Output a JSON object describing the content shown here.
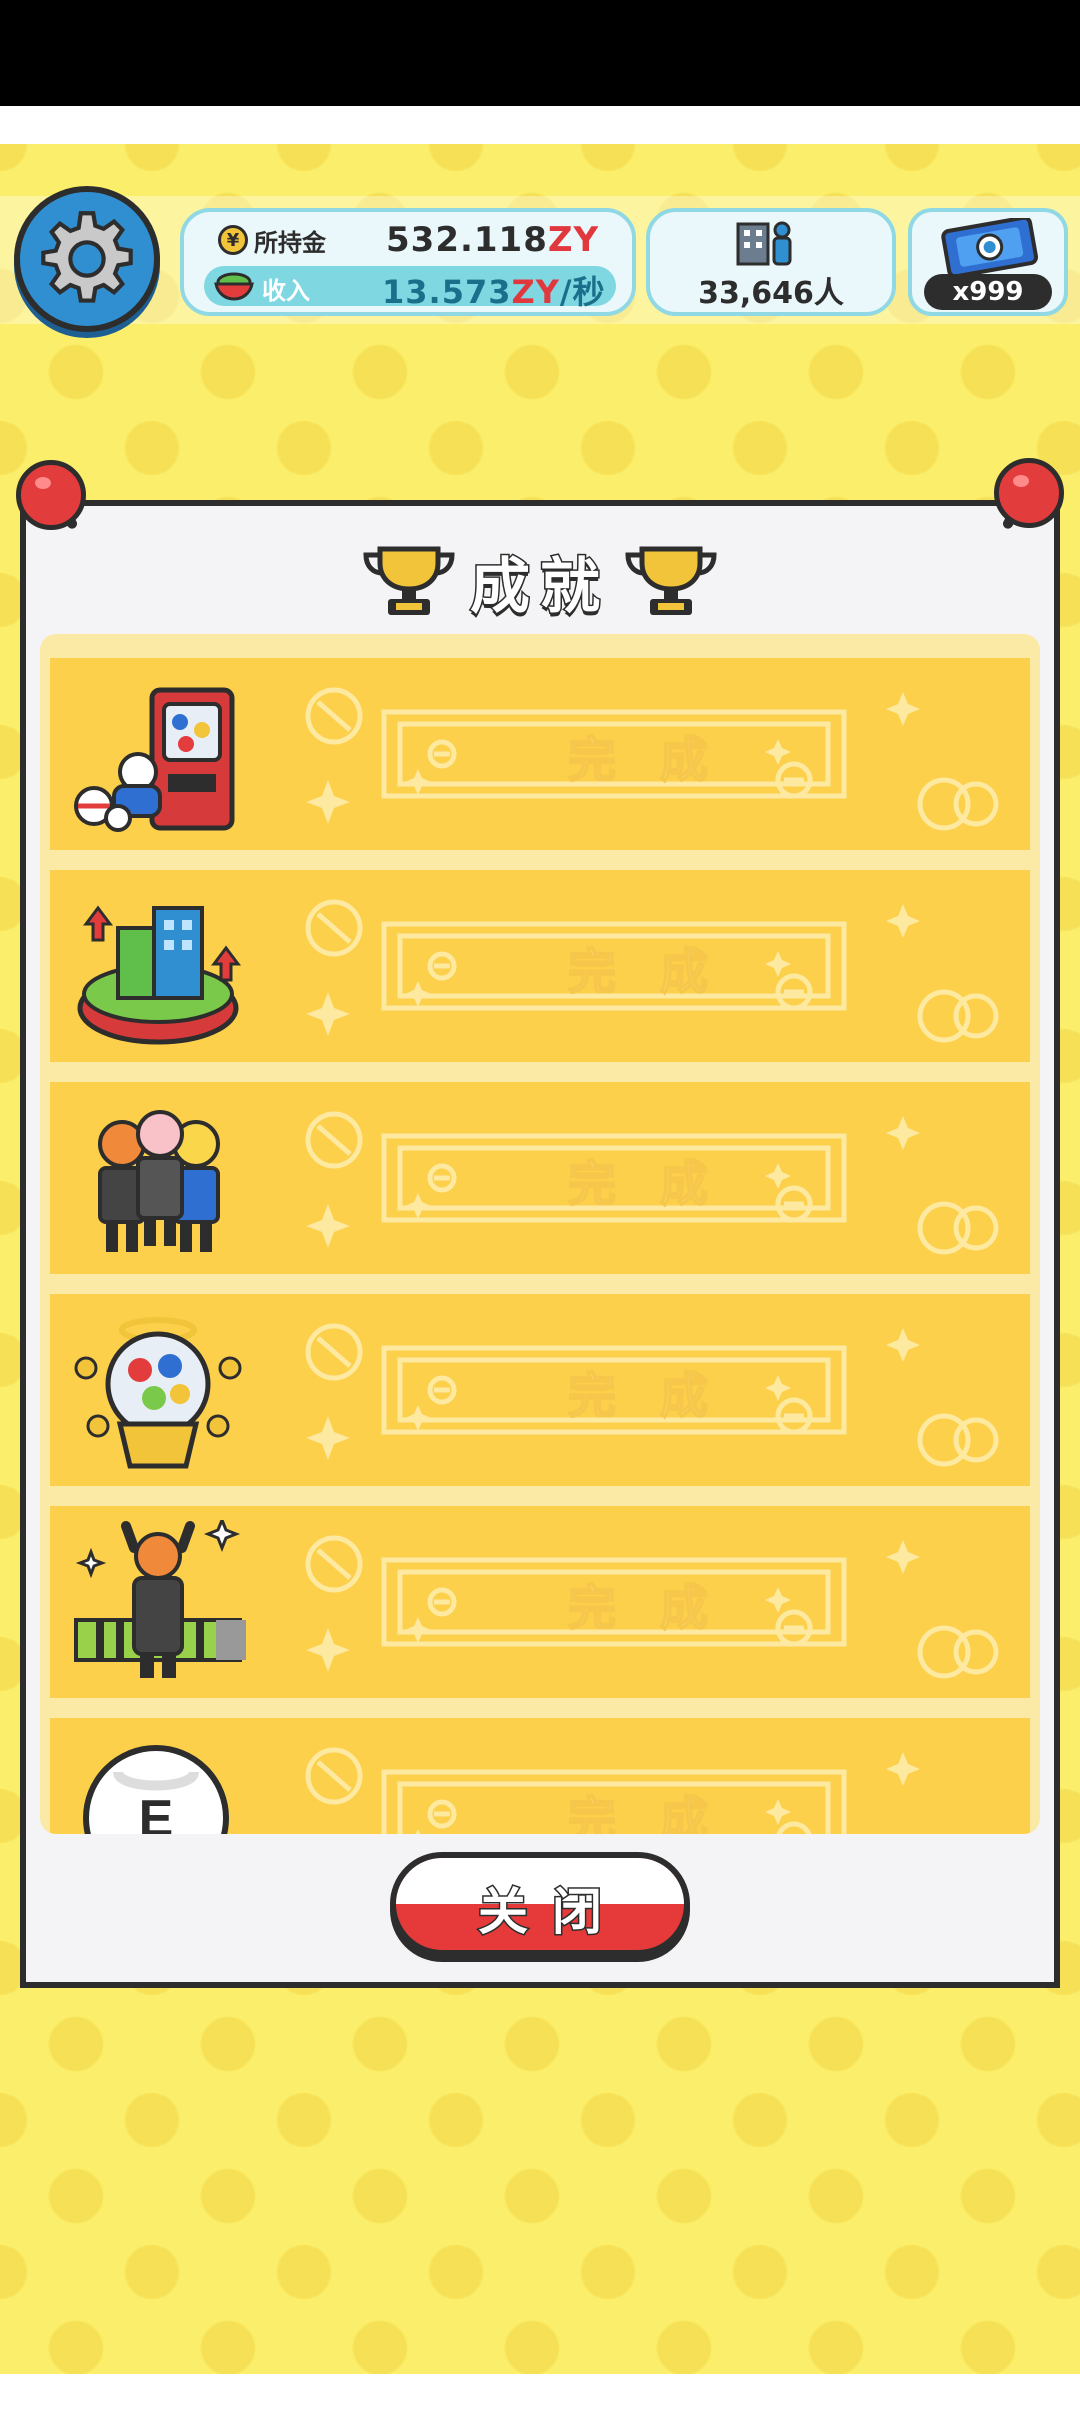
{
  "hud": {
    "money_label": "所持金",
    "money_amount": "532.118",
    "money_unit": "ZY",
    "income_label": "收入",
    "income_amount": "13.573",
    "income_unit": "ZY",
    "income_suffix": "/秒",
    "population": "33,646人",
    "tickets": "x999",
    "coin_symbol": "¥"
  },
  "dialog": {
    "title": "成就",
    "close_label": "关闭"
  },
  "achievements": [
    {
      "icon": "gacha-machine-icon",
      "label": "完成"
    },
    {
      "icon": "city-upgrade-icon",
      "label": "完成"
    },
    {
      "icon": "people-group-icon",
      "label": "完成"
    },
    {
      "icon": "golden-gacha-icon",
      "label": "完成"
    },
    {
      "icon": "worker-cheer-icon",
      "label": "完成"
    },
    {
      "icon": "e-badge-icon",
      "label": "完成"
    }
  ],
  "colors": {
    "background": "#fbee6a",
    "row": "#fcd04b",
    "accent_red": "#e23c3c",
    "panel_border": "#8fd8e4"
  }
}
